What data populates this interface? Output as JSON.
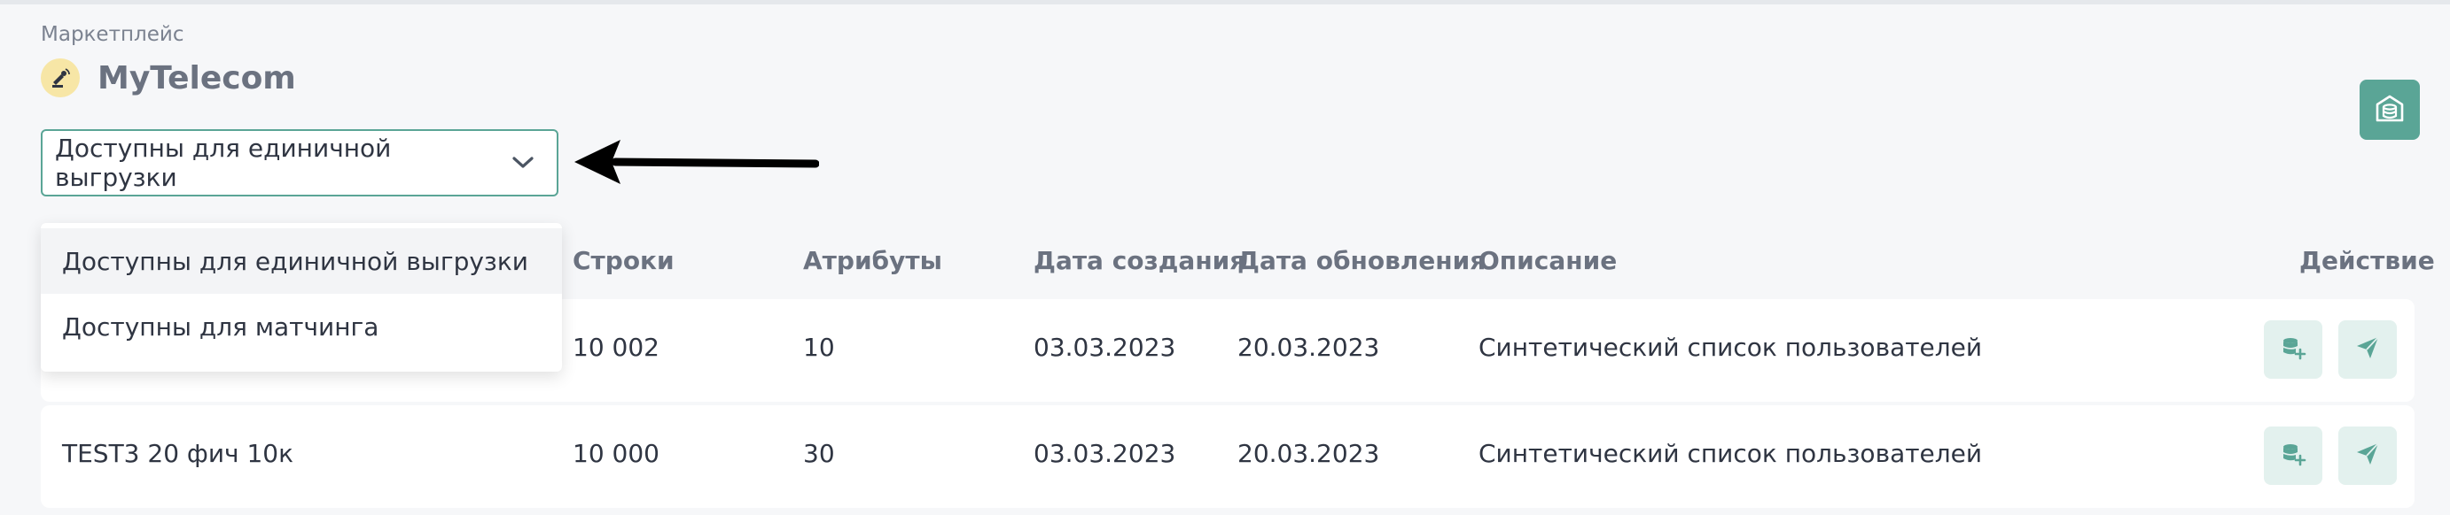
{
  "breadcrumb": "Маркетплейс",
  "brand": {
    "title": "MyTelecom"
  },
  "filter": {
    "selected": "Доступны для единичной выгрузки",
    "options": [
      "Доступны для единичной выгрузки",
      "Доступны для матчинга"
    ]
  },
  "table": {
    "headers": {
      "rows": "Строки",
      "attributes": "Атрибуты",
      "created": "Дата создания",
      "updated": "Дата обновления",
      "description": "Описание",
      "action": "Действие"
    },
    "rows": [
      {
        "name": "",
        "rows": "10 002",
        "attributes": "10",
        "created": "03.03.2023",
        "updated": "20.03.2023",
        "description": "Синтетический список пользователей"
      },
      {
        "name": "TEST3 20 фич 10к",
        "rows": "10 000",
        "attributes": "30",
        "created": "03.03.2023",
        "updated": "20.03.2023",
        "description": "Синтетический список пользователей"
      }
    ]
  },
  "colors": {
    "accent": "#5aa596",
    "accent_light": "#e3f1ee",
    "logo_bg": "#f7e6a6"
  },
  "icons": {
    "logo": "satellite-dish-icon",
    "chevron": "chevron-down-icon",
    "topright": "storage-icon",
    "row_action_1": "database-add-icon",
    "row_action_2": "send-icon",
    "annotation": "arrow-left-icon"
  }
}
